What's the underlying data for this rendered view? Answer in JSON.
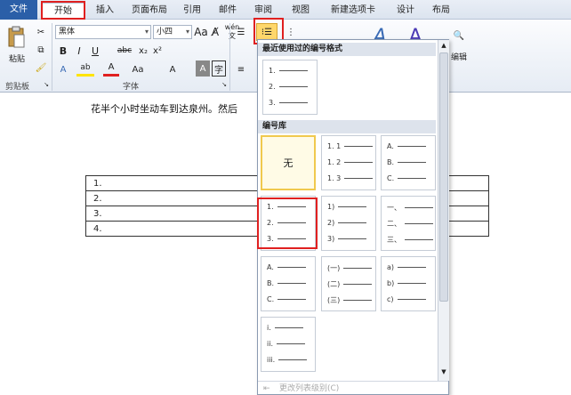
{
  "tabs": [
    "文件",
    "开始",
    "插入",
    "页面布局",
    "引用",
    "邮件",
    "审阅",
    "视图",
    "新建选项卡",
    "设计",
    "布局"
  ],
  "ribbon": {
    "paste_label": "粘贴",
    "font_name": "黑体",
    "font_size": "小四",
    "clipboard_label": "剪贴板",
    "font_group_label": "字体",
    "edit_label": "编辑",
    "wen": "wén",
    "font_A": "A",
    "shrink_grow": "A A",
    "clear": "Aa"
  },
  "document": {
    "line": "花半个小时坐动车到达泉州。然后",
    "table_rows": [
      "1.",
      "2.",
      "3.",
      "4."
    ]
  },
  "dropdown": {
    "recent_heading": "最近使用过的编号格式",
    "library_heading": "编号库",
    "none_label": "无",
    "footer": "更改列表级别(C)",
    "recent": [
      "1.",
      "2.",
      "3."
    ],
    "formats": [
      [
        "1. 1",
        "1. 2",
        "1. 3"
      ],
      [
        "A.",
        "B.",
        "C."
      ],
      [
        "1.",
        "2.",
        "3."
      ],
      [
        "1)",
        "2)",
        "3)"
      ],
      [
        "一、",
        "二、",
        "三、"
      ],
      [
        "A.",
        "B.",
        "C."
      ],
      [
        "(一)",
        "(二)",
        "(三)"
      ],
      [
        "a)",
        "b)",
        "c)"
      ],
      [
        "i.",
        "ii.",
        "iii."
      ]
    ]
  },
  "colors": {
    "highlight": "#e02020",
    "file_tab": "#2b5fa8"
  }
}
